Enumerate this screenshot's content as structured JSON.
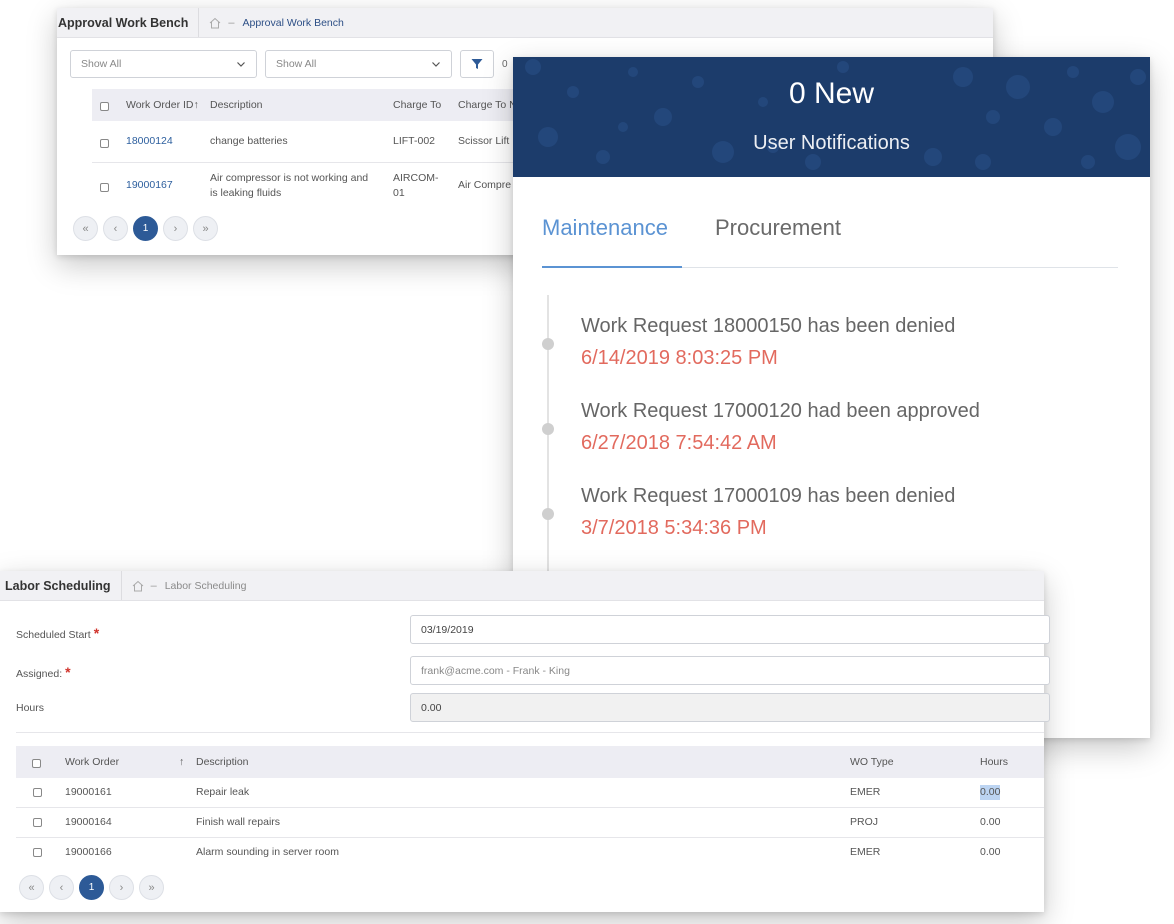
{
  "approval": {
    "title": "Approval Work Bench",
    "breadcrumb": "Approval Work Bench",
    "breadcrumb_sep": "–",
    "filter1": "Show All",
    "filter2": "Show All",
    "count": "0",
    "columns": [
      "Work Order ID",
      "Description",
      "Charge To",
      "Charge To N"
    ],
    "sort_arrow": "↑",
    "rows": [
      {
        "id": "18000124",
        "description": "change batteries",
        "charge_to": "LIFT-002",
        "charge_to_name": "Scissor Lift"
      },
      {
        "id": "19000167",
        "description_line1": "Air compressor is not working and",
        "description_line2": "is leaking fluids",
        "charge_to_line1": "AIRCOM-",
        "charge_to_line2": "01",
        "charge_to_name": "Air Compre"
      }
    ],
    "pager": {
      "first": "«",
      "prev": "‹",
      "page": "1",
      "next": "›",
      "last": "»"
    }
  },
  "notifications": {
    "count_label": "0 New",
    "subtitle": "User Notifications",
    "tabs": [
      "Maintenance",
      "Procurement"
    ],
    "active_tab": "Maintenance",
    "items": [
      {
        "message": "Work Request 18000150 has been denied",
        "date": "6/14/2019 8:03:25 PM"
      },
      {
        "message": "Work Request 17000120 had been approved",
        "date": "6/27/2018 7:54:42 AM"
      },
      {
        "message": "Work Request 17000109 has been denied",
        "date": "3/7/2018 5:34:36 PM"
      }
    ],
    "colors": {
      "banner": "#1c3c6b",
      "accent": "#5b93d3",
      "date": "#e26a5e"
    }
  },
  "labor": {
    "title": "Labor Scheduling",
    "breadcrumb": "Labor Scheduling",
    "breadcrumb_sep": "–",
    "fields": {
      "scheduled_start_label": "Scheduled Start",
      "scheduled_start_value": "03/19/2019",
      "assigned_label": "Assigned:",
      "assigned_value": "frank@acme.com - Frank - King",
      "hours_label": "Hours",
      "hours_value": "0.00",
      "required_mark": "*"
    },
    "columns": [
      "Work Order",
      "Description",
      "WO Type",
      "Hours"
    ],
    "sort_arrow": "↑",
    "rows": [
      {
        "wo": "19000161",
        "description": "Repair leak",
        "type": "EMER",
        "hours": "0.00"
      },
      {
        "wo": "19000164",
        "description": "Finish wall repairs",
        "type": "PROJ",
        "hours": "0.00"
      },
      {
        "wo": "19000166",
        "description": "Alarm sounding in server room",
        "type": "EMER",
        "hours": "0.00"
      }
    ],
    "pager": {
      "first": "«",
      "prev": "‹",
      "page": "1",
      "next": "›",
      "last": "»"
    }
  }
}
